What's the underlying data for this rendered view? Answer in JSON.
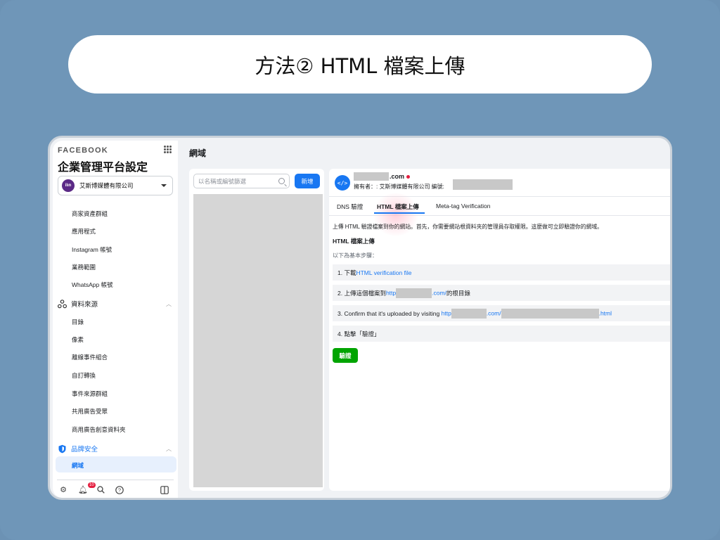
{
  "slide": {
    "title": "方法② HTML 檔案上傳"
  },
  "sidebar": {
    "brand": "FACEBOOK",
    "title": "企業管理平台設定",
    "business": "艾斯博媒體有限公司",
    "business_logo": "ilın",
    "items_top": [
      "商家資產群組",
      "應用程式",
      "Instagram 帳號",
      "業務範圍",
      "WhatsApp 帳號"
    ],
    "data_sources": {
      "label": "資料來源",
      "items": [
        "目錄",
        "像素",
        "離線事件組合",
        "自訂轉換",
        "事件來源群組",
        "共用廣告受眾",
        "商用廣告創意資料夾"
      ]
    },
    "brand_safety": {
      "label": "品牌安全",
      "items": [
        "網域"
      ]
    },
    "notification_count": "10"
  },
  "main": {
    "title": "網域",
    "search_placeholder": "以名稱或編號篩選",
    "add_label": "新增"
  },
  "detail": {
    "domain_suffix": ".com",
    "owner": "擁有者：: 艾斯博媒體有限公司   編號:",
    "tabs": [
      "DNS 驗證",
      "HTML 檔案上傳",
      "Meta-tag Verification"
    ],
    "intro": "上傳 HTML 驗證檔案到你的網站。首先，你需要網站根資料夾的管理員存取權限。這麼做可立即驗證你的網域。",
    "heading": "HTML 檔案上傳",
    "steps_label": "以下為基本步驟：",
    "step1_prefix": "1. 下載",
    "step1_link": "HTML verification file",
    "step2_prefix": "2. 上傳這個檔案到",
    "step2_link_a": "http",
    "step2_link_b": ".com/",
    "step2_suffix": "的根目錄",
    "step3_prefix": "3. Confirm that it's uploaded by visiting ",
    "step3_link_a": "http",
    "step3_link_b": ".com/",
    "step3_link_c": ".html",
    "step4": "4. 點擊「驗證」",
    "verify_label": "驗證"
  },
  "colors": {
    "accent": "#1877f2",
    "verify": "#00a400",
    "background": "#6f96b8"
  }
}
